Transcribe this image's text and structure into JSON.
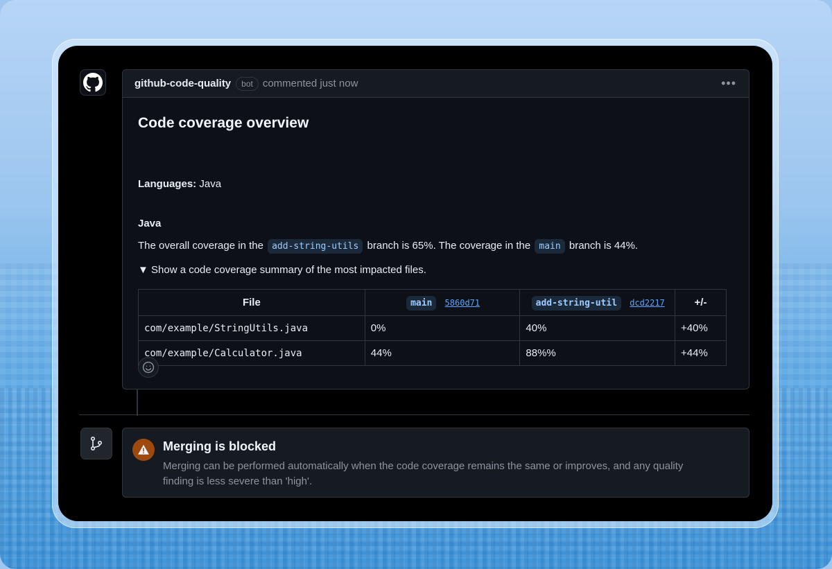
{
  "comment": {
    "author": "github-code-quality",
    "badge": "bot",
    "meta": "commented just now",
    "more_label": "•••",
    "title": "Code coverage overview",
    "languages_label": "Languages:",
    "languages_value": "Java",
    "section_heading": "Java",
    "coverage_text_1": "The overall coverage in the",
    "coverage_branch": "add-string-utils",
    "coverage_text_2": "branch is 65%. The coverage in the",
    "coverage_base": "main",
    "coverage_text_3": "branch is 44%.",
    "summary": "▼ Show a code coverage summary of the most impacted files."
  },
  "table": {
    "col_file": "File",
    "col_main_branch": "main",
    "col_main_sha": "5860d71",
    "col_head_branch": "add-string-util",
    "col_head_sha": "dcd2217",
    "col_diff": "+/-",
    "rows": [
      {
        "file": "com/example/StringUtils.java",
        "main": "0%",
        "head": "40%",
        "diff": "+40%"
      },
      {
        "file": "com/example/Calculator.java",
        "main": "44%",
        "head": "88%%",
        "diff": "+44%"
      }
    ]
  },
  "merge": {
    "title": "Merging is blocked",
    "description": "Merging can be performed automatically when the code coverage remains the same or improves, and any quality finding is less severe than 'high'."
  },
  "icons": {
    "avatar": "github-logo-icon",
    "reaction": "smiley-icon",
    "merge": "git-branch-icon",
    "warning": "warning-icon"
  }
}
